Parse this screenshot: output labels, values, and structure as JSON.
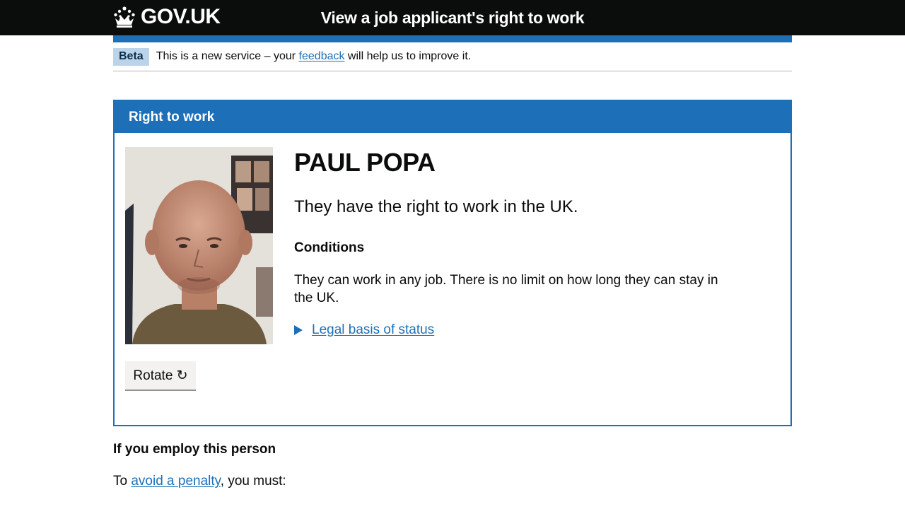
{
  "header": {
    "logo_text": "GOV.UK",
    "service_name": "View a job applicant's right to work"
  },
  "phase_banner": {
    "tag": "Beta",
    "text_before": "This is a new service – your ",
    "link": "feedback",
    "text_after": " will help us to improve it."
  },
  "card": {
    "title": "Right to work",
    "name": "PAUL POPA",
    "status": "They have the right to work in the UK.",
    "conditions_heading": "Conditions",
    "conditions_text": "They can work in any job. There is no limit on how long they can stay in the UK.",
    "details_link": "Legal basis of status",
    "rotate_label": "Rotate ↻"
  },
  "employ": {
    "heading": "If you employ this person",
    "text_before": "To ",
    "link": "avoid a penalty",
    "text_after": ", you must:"
  },
  "colors": {
    "header_bg": "#0b0c0c",
    "brand_blue": "#1d70b8",
    "tag_bg": "#bbd4ea",
    "button_bg": "#f3f2f1"
  }
}
